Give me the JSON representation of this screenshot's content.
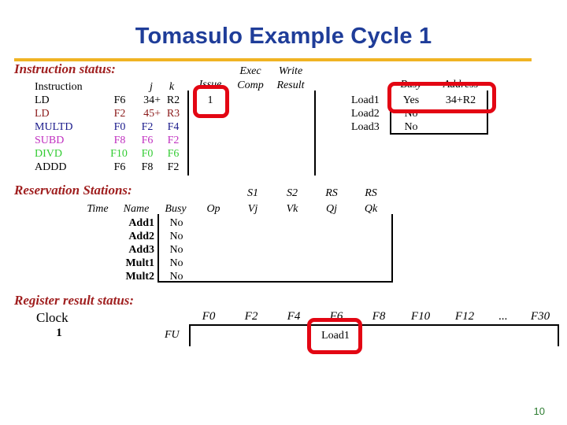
{
  "slide": {
    "title": "Tomasulo Example Cycle 1",
    "page_number": "10",
    "accent_color": "#f0b323",
    "title_color": "#1f3d99",
    "heading_color": "#a02020",
    "highlight_color": "#e30613"
  },
  "instruction_status": {
    "heading": "Instruction status:",
    "headers": {
      "instruction": "Instruction",
      "j": "j",
      "k": "k",
      "issue": "Issue",
      "exec_line1": "Exec",
      "exec_line2": "Comp",
      "write_line1": "Write",
      "write_line2": "Result"
    },
    "rows": [
      {
        "op": "LD",
        "j": "F6",
        "k": "34+",
        "k2": "R2",
        "issue": "1",
        "exec": "",
        "write": "",
        "color": "#000000"
      },
      {
        "op": "LD",
        "j": "F2",
        "k": "45+",
        "k2": "R3",
        "issue": "",
        "exec": "",
        "write": "",
        "color": "#8b1a1a"
      },
      {
        "op": "MULTD",
        "j": "F0",
        "k": "F2",
        "k2": "F4",
        "issue": "",
        "exec": "",
        "write": "",
        "color": "#1a1a8b"
      },
      {
        "op": "SUBD",
        "j": "F8",
        "k": "F6",
        "k2": "F2",
        "issue": "",
        "exec": "",
        "write": "",
        "color": "#c030c0"
      },
      {
        "op": "DIVD",
        "j": "F10",
        "k": "F0",
        "k2": "F6",
        "issue": "",
        "exec": "",
        "write": "",
        "color": "#33cc33"
      },
      {
        "op": "ADDD",
        "j": "F6",
        "k": "F8",
        "k2": "F2",
        "issue": "",
        "exec": "",
        "write": "",
        "color": "#000000"
      }
    ]
  },
  "load_queue": {
    "headers": {
      "busy": "Busy",
      "address": "Address"
    },
    "rows": [
      {
        "name": "Load1",
        "busy": "Yes",
        "address": "34+R2"
      },
      {
        "name": "Load2",
        "busy": "No",
        "address": ""
      },
      {
        "name": "Load3",
        "busy": "No",
        "address": ""
      }
    ]
  },
  "reservation_stations": {
    "heading": "Reservation Stations:",
    "headers": {
      "time": "Time",
      "name": "Name",
      "busy": "Busy",
      "op": "Op",
      "s1_top": "S1",
      "s1_bot": "Vj",
      "s2_top": "S2",
      "s2_bot": "Vk",
      "rs1_top": "RS",
      "rs1_bot": "Qj",
      "rs2_top": "RS",
      "rs2_bot": "Qk"
    },
    "rows": [
      {
        "time": "",
        "name": "Add1",
        "busy": "No",
        "op": "",
        "vj": "",
        "vk": "",
        "qj": "",
        "qk": ""
      },
      {
        "time": "",
        "name": "Add2",
        "busy": "No",
        "op": "",
        "vj": "",
        "vk": "",
        "qj": "",
        "qk": ""
      },
      {
        "time": "",
        "name": "Add3",
        "busy": "No",
        "op": "",
        "vj": "",
        "vk": "",
        "qj": "",
        "qk": ""
      },
      {
        "time": "",
        "name": "Mult1",
        "busy": "No",
        "op": "",
        "vj": "",
        "vk": "",
        "qj": "",
        "qk": ""
      },
      {
        "time": "",
        "name": "Mult2",
        "busy": "No",
        "op": "",
        "vj": "",
        "vk": "",
        "qj": "",
        "qk": ""
      }
    ]
  },
  "register_result_status": {
    "heading": "Register result status:",
    "clock_label": "Clock",
    "clock_value": "1",
    "fu_label": "FU",
    "registers": [
      "F0",
      "F2",
      "F4",
      "F6",
      "F8",
      "F10",
      "F12",
      "...",
      "F30"
    ],
    "values": [
      "",
      "",
      "",
      "Load1",
      "",
      "",
      "",
      "",
      ""
    ]
  }
}
